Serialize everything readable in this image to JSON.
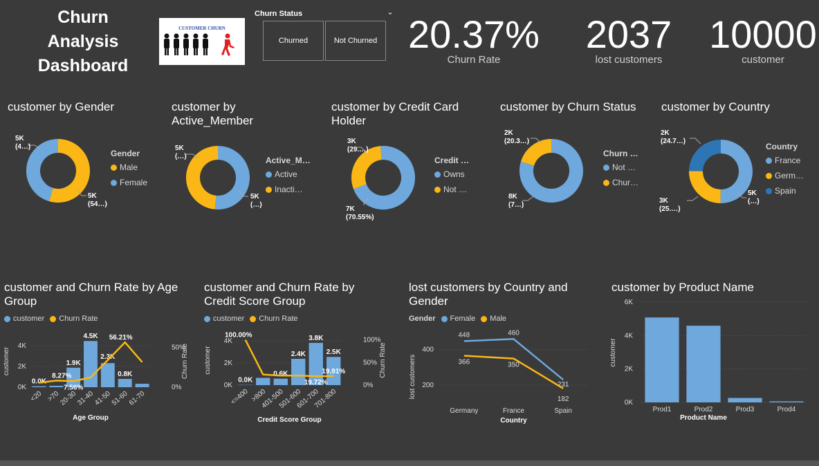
{
  "header": {
    "title": "Churn Analysis Dashboard",
    "logo_text": "CUSTOMER CHURN"
  },
  "slicer": {
    "title": "Churn Status",
    "options": [
      "Churned",
      "Not Churned"
    ]
  },
  "kpis": [
    {
      "value": "20.37%",
      "label": "Churn Rate"
    },
    {
      "value": "2037",
      "label": "lost customers"
    },
    {
      "value": "10000",
      "label": "customer"
    }
  ],
  "colors": {
    "light_blue": "#6fa8dc",
    "orange": "#fbb715",
    "dark_blue": "#2e75b6",
    "background": "#3a3a3a"
  },
  "donuts": [
    {
      "title": "customer by Gender",
      "legend_title": "Gender",
      "legend": [
        "Male",
        "Female"
      ],
      "labels": [
        {
          "l1": "5K",
          "l2": "(4…)"
        },
        {
          "l1": "5K",
          "l2": "(54…)"
        }
      ]
    },
    {
      "title": "customer by Active_Member",
      "legend_title": "Active_M…",
      "legend": [
        "Active",
        "Inacti…"
      ],
      "labels": [
        {
          "l1": "5K",
          "l2": "(…)"
        },
        {
          "l1": "5K",
          "l2": "(…)"
        }
      ]
    },
    {
      "title": "customer by Credit Card Holder",
      "legend_title": "Credit …",
      "legend": [
        "Owns",
        "Not …"
      ],
      "labels": [
        {
          "l1": "3K",
          "l2": "(29.…)"
        },
        {
          "l1": "7K",
          "l2": "(70.55%)"
        }
      ]
    },
    {
      "title": "customer by Churn Status",
      "legend_title": "Churn …",
      "legend": [
        "Not …",
        "Chur…"
      ],
      "labels": [
        {
          "l1": "2K",
          "l2": "(20.3…)"
        },
        {
          "l1": "8K",
          "l2": "(7…)"
        }
      ]
    },
    {
      "title": "customer by Country",
      "legend_title": "Country",
      "legend": [
        "France",
        "Germ…",
        "Spain"
      ],
      "labels": [
        {
          "l1": "2K",
          "l2": "(24.7…)"
        },
        {
          "l1": "3K",
          "l2": "(25.…)"
        },
        {
          "l1": "5K",
          "l2": "(…)"
        }
      ]
    }
  ],
  "chart_data": [
    {
      "type": "pie",
      "title": "customer by Gender",
      "categories": [
        "Male",
        "Female"
      ],
      "values": [
        54.57,
        45.43
      ]
    },
    {
      "type": "pie",
      "title": "customer by Active_Member",
      "categories": [
        "Active",
        "Inacti…"
      ],
      "values": [
        51.5,
        48.5
      ]
    },
    {
      "type": "pie",
      "title": "customer by Credit Card Holder",
      "categories": [
        "Owns",
        "Not …"
      ],
      "values": [
        70.55,
        29.45
      ]
    },
    {
      "type": "pie",
      "title": "customer by Churn Status",
      "categories": [
        "Not …",
        "Chur…"
      ],
      "values": [
        79.63,
        20.37
      ]
    },
    {
      "type": "pie",
      "title": "customer by Country",
      "categories": [
        "France",
        "Germ…",
        "Spain"
      ],
      "values": [
        50.14,
        25.09,
        24.77
      ]
    },
    {
      "type": "bar",
      "title": "customer and Churn Rate by Age Group",
      "categories": [
        "<20",
        ">70",
        "20-30",
        "31-40",
        "41-50",
        "51-60",
        "61-70"
      ],
      "series": [
        {
          "name": "customer",
          "values": [
            89,
            133,
            1879,
            4451,
            2320,
            797,
            331
          ]
        },
        {
          "name": "Churn Rate",
          "values": [
            5.6,
            8.27,
            7.56,
            12.1,
            34.0,
            56.21,
            31.4
          ]
        }
      ],
      "bar_labels": [
        "0.0K",
        "",
        "1.9K",
        "4.5K",
        "2.3K",
        "0.8K",
        ""
      ],
      "line_labels": [
        "",
        "8.27%",
        "7.56%",
        "",
        "",
        "56.21%",
        ""
      ],
      "xlabel": "Age Group",
      "ylabel": "customer",
      "y2label": "Churn Rate",
      "y_ticks": [
        "0K",
        "2K",
        "4K"
      ],
      "y2_ticks": [
        "0%",
        "50%"
      ],
      "ylim": [
        0,
        5000
      ],
      "y2lim": [
        0,
        65
      ]
    },
    {
      "type": "bar",
      "title": "customer and Churn Rate by Credit Score Group",
      "categories": [
        "<=400",
        ">800",
        "401-500",
        "501-600",
        "601-700",
        "701-800"
      ],
      "series": [
        {
          "name": "customer",
          "values": [
            19,
            655,
            582,
            2377,
            3818,
            2549
          ]
        },
        {
          "name": "Churn Rate",
          "values": [
            100.0,
            23.4,
            21.1,
            21.0,
            19.72,
            19.91
          ]
        }
      ],
      "bar_labels": [
        "0.0K",
        "",
        "0.6K",
        "2.4K",
        "3.8K",
        "2.5K"
      ],
      "line_labels": [
        "100.00%",
        "",
        "",
        "",
        "19.72%",
        "19.91%"
      ],
      "xlabel": "Credit Score Group",
      "ylabel": "customer",
      "y2label": "Churn Rate",
      "y_ticks": [
        "0K",
        "2K",
        "4K"
      ],
      "y2_ticks": [
        "0%",
        "50%",
        "100%"
      ],
      "ylim": [
        0,
        4500
      ],
      "y2lim": [
        0,
        110
      ]
    },
    {
      "type": "line",
      "title": "lost customers by Country and Gender",
      "categories": [
        "Germany",
        "France",
        "Spain"
      ],
      "series": [
        {
          "name": "Female",
          "values": [
            448,
            460,
            231
          ]
        },
        {
          "name": "Male",
          "values": [
            366,
            350,
            182
          ]
        }
      ],
      "legend_title": "Gender",
      "xlabel": "Country",
      "ylabel": "lost customers",
      "y_ticks": [
        "200",
        "400"
      ],
      "ylim": [
        150,
        500
      ]
    },
    {
      "type": "bar",
      "title": "customer by Product Name",
      "categories": [
        "Prod1",
        "Prod2",
        "Prod3",
        "Prod4"
      ],
      "values": [
        5084,
        4590,
        266,
        60
      ],
      "xlabel": "Product Name",
      "ylabel": "customer",
      "y_ticks": [
        "0K",
        "2K",
        "4K",
        "6K"
      ],
      "ylim": [
        0,
        6000
      ]
    }
  ]
}
